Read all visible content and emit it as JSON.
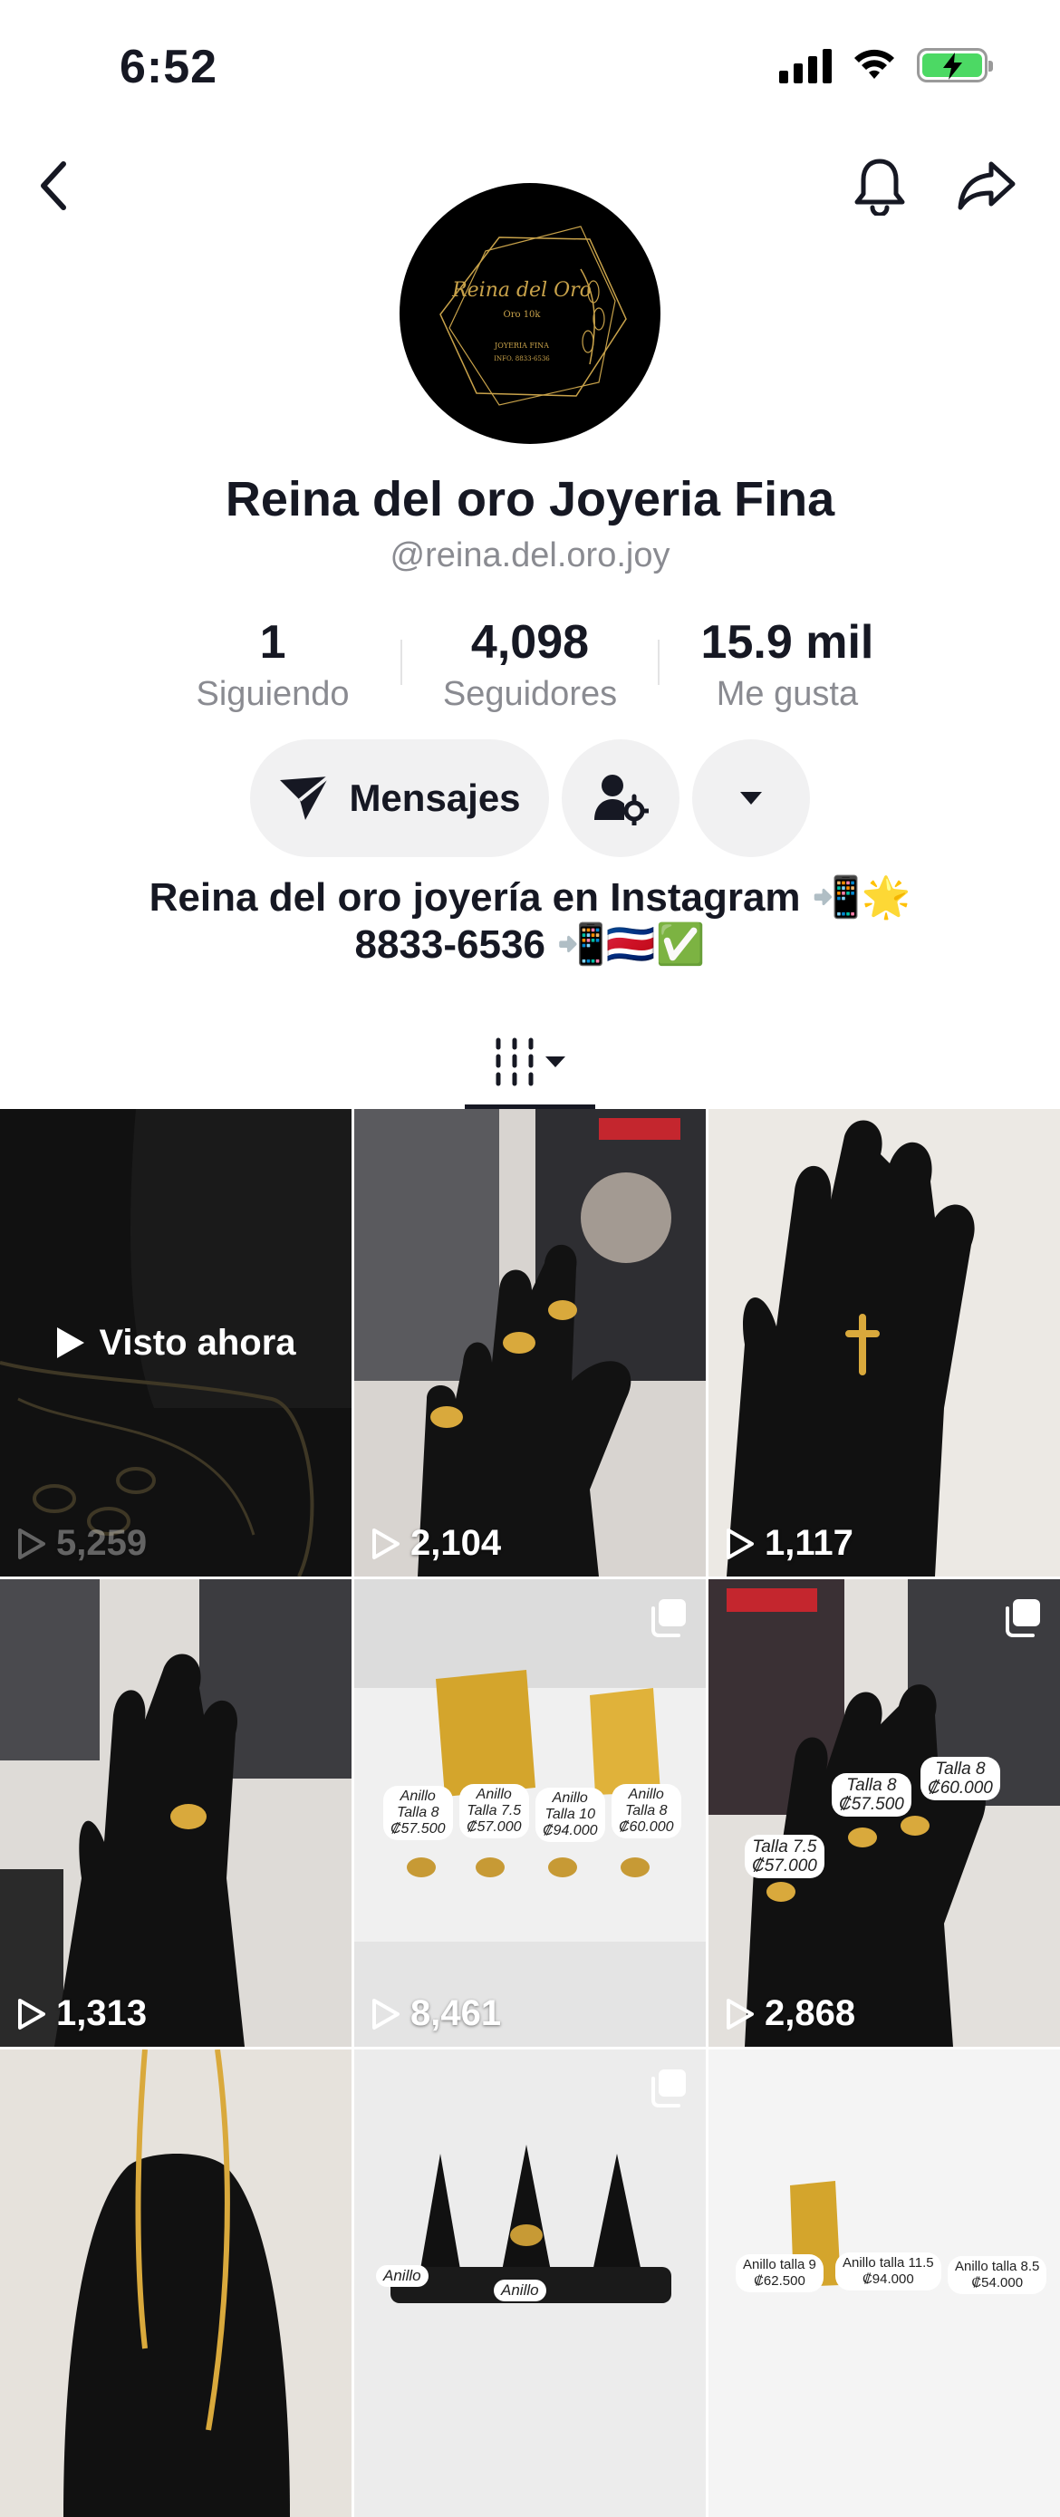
{
  "status_bar": {
    "time": "6:52"
  },
  "nav": {
    "back_icon": "chevron-left-icon",
    "bell_icon": "bell-icon",
    "share_icon": "share-icon"
  },
  "profile": {
    "avatar_logo": {
      "title": "Reina del Oro",
      "subtitle": "Oro 10k",
      "line1": "JOYERIA FINA",
      "line2": "INFO. 8833-6536"
    },
    "display_name": "Reina del oro Joyeria Fina",
    "handle": "@reina.del.oro.joy"
  },
  "stats": [
    {
      "value": "1",
      "label": "Siguiendo"
    },
    {
      "value": "4,098",
      "label": "Seguidores"
    },
    {
      "value": "15.9 mil",
      "label": "Me gusta"
    }
  ],
  "actions": {
    "message_label": "Mensajes"
  },
  "bio": {
    "line1": "Reina del oro joyería en Instagram 📲🌟",
    "line2": "8833-6536 📲🇨🇷✅"
  },
  "videos": [
    {
      "views": "5,259",
      "watched_label": "Visto ahora",
      "multi": false,
      "bg": "#2a2a2a"
    },
    {
      "views": "2,104",
      "multi": false,
      "bg": "#3b3b3e"
    },
    {
      "views": "1,117",
      "multi": false,
      "bg": "#e9e6e2"
    },
    {
      "views": "1,313",
      "multi": false,
      "bg": "#d9d6d3"
    },
    {
      "views": "8,461",
      "multi": true,
      "bg": "#eeeeee",
      "tags": [
        [
          "Anillo",
          "Talla 8",
          "₡57.500"
        ],
        [
          "Anillo",
          "Talla 7.5",
          "₡57.000"
        ],
        [
          "Anillo",
          "Talla 10",
          "₡94.000"
        ],
        [
          "Anillo",
          "Talla 8",
          "₡60.000"
        ]
      ]
    },
    {
      "views": "2,868",
      "multi": true,
      "bg": "#4a3a3c",
      "tags": [
        [
          "Talla 8",
          "₡57.500"
        ],
        [
          "Talla 8",
          "₡60.000"
        ],
        [
          "Talla 7.5",
          "₡57.000"
        ]
      ]
    },
    {
      "views": "",
      "multi": false,
      "bg": "#ddd8d2"
    },
    {
      "views": "",
      "multi": true,
      "bg": "#e4e4e4",
      "tags": [
        [
          "Anillo"
        ],
        [
          "Anillo"
        ]
      ]
    },
    {
      "views": "",
      "multi": false,
      "bg": "#f2f2f2",
      "tags": [
        [
          "Anillo talla 9",
          "₡62.500"
        ],
        [
          "Anillo talla 11.5",
          "₡94.000"
        ],
        [
          "Anillo talla 8.5",
          "₡54.000"
        ]
      ]
    }
  ]
}
